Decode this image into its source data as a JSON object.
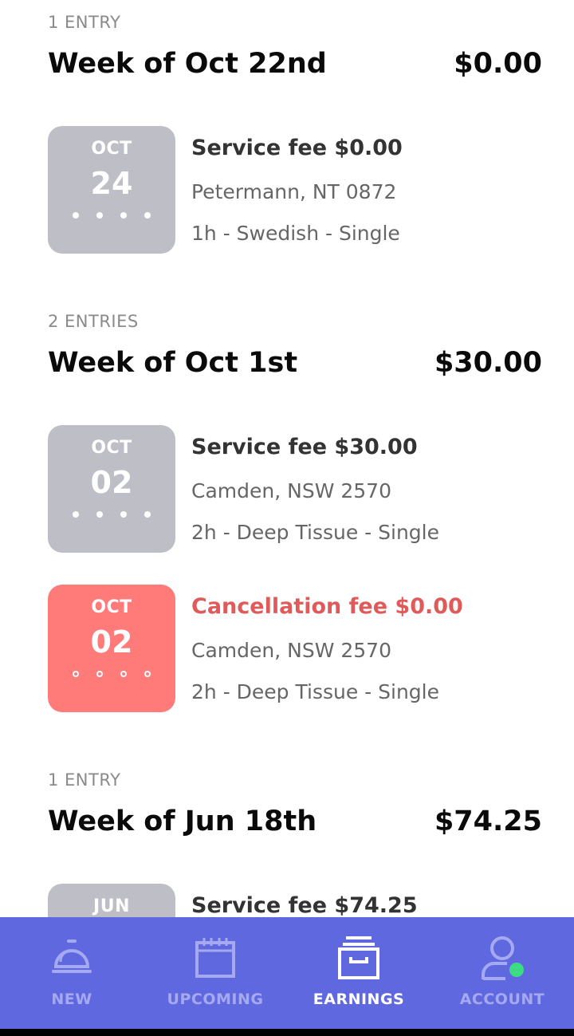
{
  "weeks": [
    {
      "count": "1 ENTRY",
      "title": "Week of Oct 22nd",
      "total": "$0.00",
      "entries": [
        {
          "month": "OCT",
          "day": "24",
          "fee": "Service fee $0.00",
          "location": "Petermann, NT 0872",
          "description": "1h - Swedish - Single",
          "type": "service"
        }
      ]
    },
    {
      "count": "2 ENTRIES",
      "title": "Week of Oct 1st",
      "total": "$30.00",
      "entries": [
        {
          "month": "OCT",
          "day": "02",
          "fee": "Service fee $30.00",
          "location": "Camden, NSW 2570",
          "description": "2h - Deep Tissue - Single",
          "type": "service"
        },
        {
          "month": "OCT",
          "day": "02",
          "fee": "Cancellation fee $0.00",
          "location": "Camden, NSW 2570",
          "description": "2h - Deep Tissue - Single",
          "type": "cancellation"
        }
      ]
    },
    {
      "count": "1 ENTRY",
      "title": "Week of Jun 18th",
      "total": "$74.25",
      "entries": [
        {
          "month": "JUN",
          "day": "",
          "fee": "Service fee $74.25",
          "location": "",
          "description": "",
          "type": "service"
        }
      ]
    }
  ],
  "tabs": [
    {
      "label": "NEW",
      "icon": "bell-icon",
      "active": false
    },
    {
      "label": "UPCOMING",
      "icon": "calendar-icon",
      "active": false
    },
    {
      "label": "EARNINGS",
      "icon": "archive-box-icon",
      "active": true
    },
    {
      "label": "ACCOUNT",
      "icon": "user-icon",
      "active": false
    }
  ],
  "colors": {
    "tabbar": "#6068e0",
    "badge": "#bebec6",
    "cancel_badge": "#ff7b79",
    "cancel_text": "#e05a5a",
    "status_dot": "#3ddc84"
  }
}
